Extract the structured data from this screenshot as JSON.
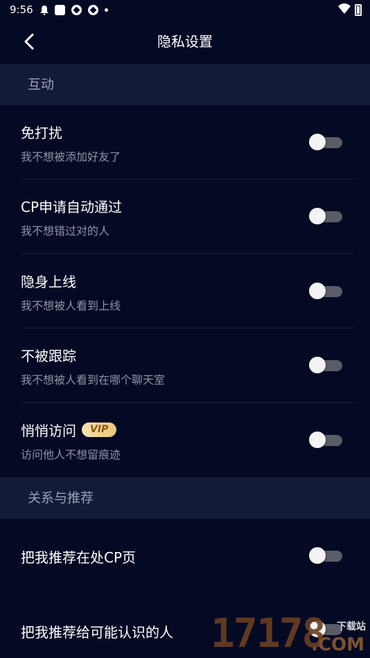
{
  "status_bar": {
    "time": "9:56",
    "icons": [
      "bell-icon",
      "app-square-icon",
      "ball-icon",
      "ball-icon",
      "dot-icon",
      "wifi-icon",
      "battery-icon"
    ]
  },
  "header": {
    "title": "隐私设置",
    "back_icon": "chevron-left-icon"
  },
  "sections": {
    "interaction": {
      "title": "互动",
      "items": [
        {
          "title": "免打扰",
          "subtitle": "我不想被添加好友了",
          "enabled": false
        },
        {
          "title": "CP申请自动通过",
          "subtitle": "我不想错过对的人",
          "enabled": false
        },
        {
          "title": "隐身上线",
          "subtitle": "我不想被人看到上线",
          "enabled": false
        },
        {
          "title": "不被跟踪",
          "subtitle": "我不想被人看到在哪个聊天室",
          "enabled": false
        },
        {
          "title": "悄悄访问",
          "badge": "VIP",
          "subtitle": "访问他人不想留痕迹",
          "enabled": false
        }
      ]
    },
    "relations": {
      "title": "关系与推荐",
      "items": [
        {
          "title": "把我推荐在处CP页",
          "enabled": false
        },
        {
          "title": "把我推荐给可能认识的人",
          "enabled": false
        }
      ]
    }
  },
  "watermark": {
    "digits": "17178",
    "domain": ".COM",
    "site_label": "下载站"
  },
  "colors": {
    "background": "#050a24",
    "section_header_bg": "#141b39",
    "subtitle_text": "#8e93a6",
    "toggle_track_off": "#5a5c66",
    "vip_badge": "#e9c57c"
  }
}
